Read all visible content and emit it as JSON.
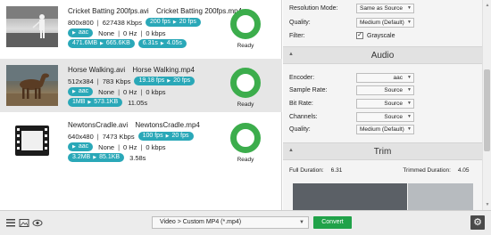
{
  "files": [
    {
      "source_name": "Cricket Batting 200fps.avi",
      "output_name": "Cricket Batting 200fps.mp4",
      "resolution": "800x800",
      "bitrate": "627438 Kbps",
      "fps_from": "200 fps",
      "fps_to": "20 fps",
      "audio_codec": "aac",
      "audio_channels": "None",
      "audio_freq": "0 Hz",
      "audio_bitrate": "0 kbps",
      "size_from": "471.6MB",
      "size_to": "665.6KB",
      "duration_from": "6.31s",
      "duration_to": "4.05s",
      "duration_pill": true,
      "status": "Ready",
      "thumbnail": "cricket-thumbnail"
    },
    {
      "source_name": "Horse Walking.avi",
      "output_name": "Horse Walking.mp4",
      "resolution": "512x384",
      "bitrate": "783 Kbps",
      "fps_from": "19.18 fps",
      "fps_to": "20 fps",
      "audio_codec": "aac",
      "audio_channels": "None",
      "audio_freq": "0 Hz",
      "audio_bitrate": "0 kbps",
      "size_from": "1MB",
      "size_to": "573.1KB",
      "duration_plain": "11.05s",
      "status": "Ready",
      "thumbnail": "horse-thumbnail"
    },
    {
      "source_name": "NewtonsCradle.avi",
      "output_name": "NewtonsCradle.mp4",
      "resolution": "640x480",
      "bitrate": "7473 Kbps",
      "fps_from": "100 fps",
      "fps_to": "20 fps",
      "audio_codec": "aac",
      "audio_channels": "None",
      "audio_freq": "0 Hz",
      "audio_bitrate": "0 kbps",
      "size_from": "3.2MB",
      "size_to": "85.1KB",
      "duration_plain": "3.58s",
      "status": "Ready",
      "thumbnail": "film-icon"
    }
  ],
  "video_settings": {
    "resolution_mode_label": "Resolution Mode:",
    "resolution_mode_value": "Same as Source",
    "quality_label": "Quality:",
    "quality_value": "Medium (Default)",
    "filter_label": "Filter:",
    "filter_value": "Grayscale",
    "filter_checked": true
  },
  "audio_section": {
    "title": "Audio",
    "encoder_label": "Encoder:",
    "encoder_value": "aac",
    "sample_rate_label": "Sample Rate:",
    "sample_rate_value": "Source",
    "bit_rate_label": "Bit Rate:",
    "bit_rate_value": "Source",
    "channels_label": "Channels:",
    "channels_value": "Source",
    "quality_label": "Quality:",
    "quality_value": "Medium (Default)"
  },
  "trim_section": {
    "title": "Trim",
    "full_duration_label": "Full Duration:",
    "full_duration_value": "6.31",
    "trimmed_duration_label": "Trimmed Duration:",
    "trimmed_duration_value": "4.05",
    "trimmed_fraction": 0.64
  },
  "toolbar": {
    "format_value": "Video > Custom MP4 (*.mp4)",
    "convert_label": "Convert"
  },
  "colors": {
    "pill": "#2aa8b8",
    "ready_ring": "#3cad4c",
    "convert": "#21a249"
  }
}
